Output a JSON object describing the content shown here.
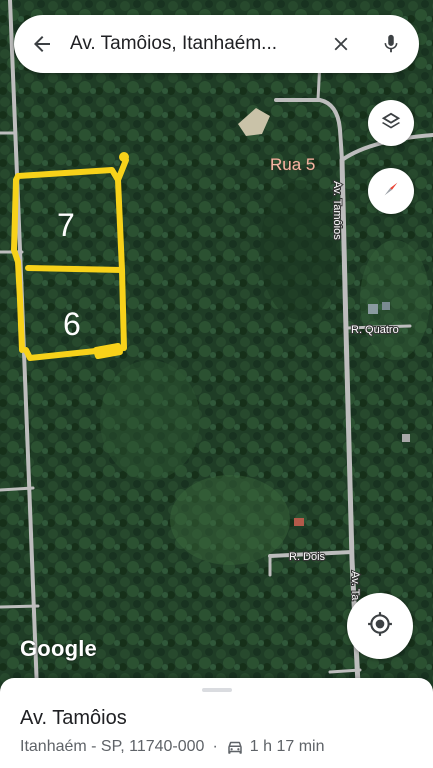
{
  "search": {
    "query": "Av. Tamôios, Itanhaém...",
    "back_icon": "arrow-back-icon",
    "clear_icon": "close-icon",
    "mic_icon": "mic-icon"
  },
  "map": {
    "road_labels": {
      "rua5": "Rua 5",
      "av_tamoios_top": "Av. Tamôios",
      "r_quatro": "R. Quatro",
      "r_dois": "R. Dois",
      "av_tamoios_bottom": "Av. Ta"
    },
    "lot_labels": [
      "7",
      "6"
    ],
    "attribution": "Google",
    "annotation_color": "#f7d21a",
    "road_color": "#bdbdbd",
    "forest_color": "#1f3d26"
  },
  "controls": {
    "layers_icon": "layers-icon",
    "compass_icon": "compass-icon",
    "location_icon": "my-location-icon"
  },
  "sheet": {
    "title": "Av. Tamôios",
    "address": "Itanhaém - SP, 11740-000",
    "separator": "·",
    "travel_time": "1 h 17 min",
    "travel_icon": "car-icon"
  }
}
